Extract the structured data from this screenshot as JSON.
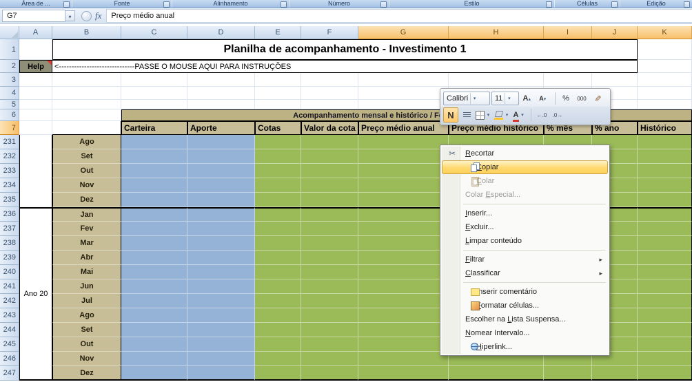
{
  "ribbon": {
    "groups": [
      {
        "label": "Área de ..."
      },
      {
        "label": "Fonte"
      },
      {
        "label": "Alinhamento"
      },
      {
        "label": "Número"
      },
      {
        "label": "Estilo"
      },
      {
        "label": "Células"
      },
      {
        "label": "Edição"
      }
    ]
  },
  "formula_bar": {
    "name_box": "G7",
    "fx_label": "fx",
    "formula": "Preço médio anual"
  },
  "sheet": {
    "columns": [
      "A",
      "B",
      "C",
      "D",
      "E",
      "F",
      "G",
      "H",
      "I",
      "J",
      "K"
    ],
    "row_numbers_top": [
      "1",
      "2",
      "3",
      "4",
      "5",
      "6",
      "7"
    ],
    "title": "Planilha de acompanhamento - Investimento 1",
    "help": {
      "label": "Help",
      "instructions": "<------------------------------PASSE O MOUSE AQUI PARA INSTRUÇÕES"
    },
    "section_header": "Acompanhamento mensal e histórico / Fechamento dos meses",
    "table_headers": [
      "Carteira",
      "Aporte",
      "Cotas",
      "Valor da cota",
      "Preço médio anual",
      "Preço médio histórico",
      "% mês",
      "% ano",
      "Histórico"
    ],
    "year_label": "Ano 20",
    "data_rows": [
      {
        "num": "231",
        "month": "Ago"
      },
      {
        "num": "232",
        "month": "Set"
      },
      {
        "num": "233",
        "month": "Out"
      },
      {
        "num": "234",
        "month": "Nov"
      },
      {
        "num": "235",
        "month": "Dez"
      },
      {
        "num": "236",
        "month": "Jan"
      },
      {
        "num": "237",
        "month": "Fev"
      },
      {
        "num": "238",
        "month": "Mar"
      },
      {
        "num": "239",
        "month": "Abr"
      },
      {
        "num": "240",
        "month": "Mai"
      },
      {
        "num": "241",
        "month": "Jun"
      },
      {
        "num": "242",
        "month": "Jul"
      },
      {
        "num": "243",
        "month": "Ago"
      },
      {
        "num": "244",
        "month": "Set"
      },
      {
        "num": "245",
        "month": "Out"
      },
      {
        "num": "246",
        "month": "Nov"
      },
      {
        "num": "247",
        "month": "Dez"
      }
    ],
    "colors": {
      "blue_cell": "#95B3D7",
      "green_cell": "#9BBB59",
      "tan_cell": "#C7BE97",
      "band_cell": "#BCB284",
      "selected_header": "#F8C06A"
    }
  },
  "mini_toolbar": {
    "font_name": "Calibri",
    "font_size": "11",
    "labels": {
      "grow_font": "A",
      "shrink_font": "A",
      "percent": "%",
      "thousands": "000",
      "bold": "N",
      "font_color": "A",
      "increase_decimal": "←.0",
      "decrease_decimal": ".0→"
    }
  },
  "context_menu": {
    "highlight_color": "#FFD96F",
    "items": [
      {
        "type": "item",
        "label": "Recortar",
        "accel": "R",
        "icon": "cut"
      },
      {
        "type": "item",
        "label": "Copiar",
        "accel": "C",
        "icon": "copy",
        "state": "highlighted"
      },
      {
        "type": "item",
        "label": "Colar",
        "accel": "C",
        "icon": "paste",
        "state": "disabled"
      },
      {
        "type": "item",
        "label": "Colar Especial...",
        "accel": "E",
        "state": "disabled"
      },
      {
        "type": "separator"
      },
      {
        "type": "item",
        "label": "Inserir...",
        "accel": "I"
      },
      {
        "type": "item",
        "label": "Excluir...",
        "accel": "E"
      },
      {
        "type": "item",
        "label": "Limpar conteúdo",
        "accel": "L"
      },
      {
        "type": "separator"
      },
      {
        "type": "item",
        "label": "Filtrar",
        "accel": "F",
        "submenu": true
      },
      {
        "type": "item",
        "label": "Classificar",
        "accel": "C",
        "submenu": true
      },
      {
        "type": "separator"
      },
      {
        "type": "item",
        "label": "Inserir comentário",
        "accel": "I",
        "icon": "comment"
      },
      {
        "type": "item",
        "label": "Formatar células...",
        "accel": "F",
        "icon": "format"
      },
      {
        "type": "item",
        "label": "Escolher na Lista Suspensa...",
        "accel": "L"
      },
      {
        "type": "item",
        "label": "Nomear Intervalo...",
        "accel": "N"
      },
      {
        "type": "item",
        "label": "Hiperlink...",
        "accel": "H",
        "icon": "link"
      }
    ]
  }
}
